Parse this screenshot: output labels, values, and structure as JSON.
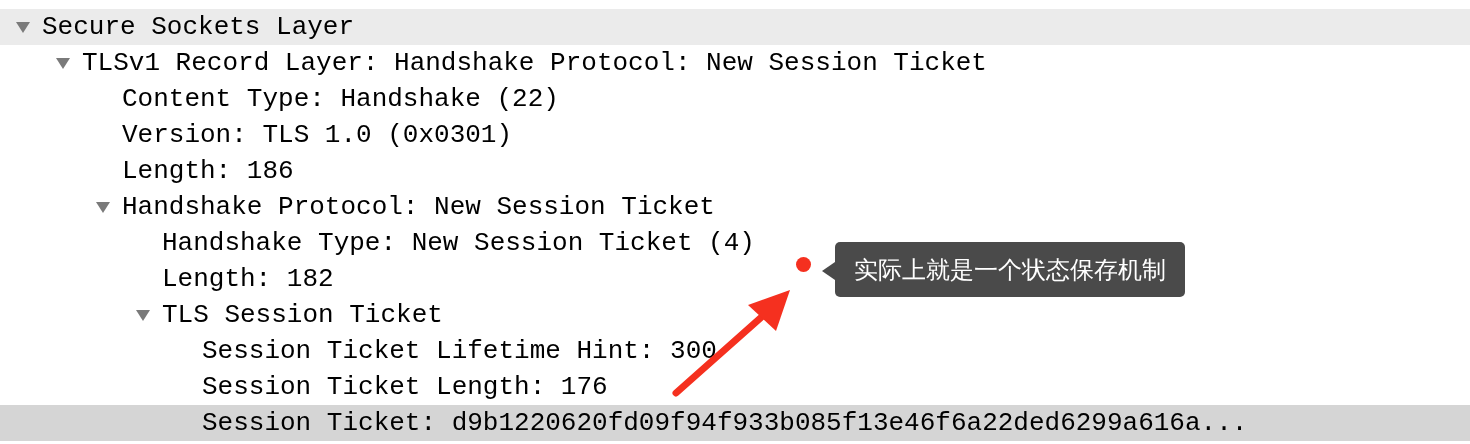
{
  "tree": [
    {
      "label": "Secure Sockets Layer",
      "expanded": true,
      "highlighted": true,
      "selected": false,
      "children": [
        {
          "label": "TLSv1 Record Layer: Handshake Protocol: New Session Ticket",
          "expanded": true,
          "highlighted": false,
          "selected": false,
          "children": [
            {
              "label": "Content Type: Handshake (22)",
              "highlighted": false,
              "selected": false
            },
            {
              "label": "Version: TLS 1.0 (0x0301)",
              "highlighted": false,
              "selected": false
            },
            {
              "label": "Length: 186",
              "highlighted": false,
              "selected": false
            },
            {
              "label": "Handshake Protocol: New Session Ticket",
              "expanded": true,
              "highlighted": false,
              "selected": false,
              "children": [
                {
                  "label": "Handshake Type: New Session Ticket (4)",
                  "highlighted": false,
                  "selected": false
                },
                {
                  "label": "Length: 182",
                  "highlighted": false,
                  "selected": false
                },
                {
                  "label": "TLS Session Ticket",
                  "expanded": true,
                  "highlighted": false,
                  "selected": false,
                  "children": [
                    {
                      "label": "Session Ticket Lifetime Hint: 300",
                      "highlighted": false,
                      "selected": false
                    },
                    {
                      "label": "Session Ticket Length: 176",
                      "highlighted": false,
                      "selected": false
                    },
                    {
                      "label": "Session Ticket: d9b1220620fd09f94f933b085f13e46f6a22ded6299a616a...",
                      "highlighted": false,
                      "selected": true
                    }
                  ]
                }
              ]
            }
          ]
        }
      ]
    }
  ],
  "annotation": {
    "text": "实际上就是一个状态保存机制"
  }
}
